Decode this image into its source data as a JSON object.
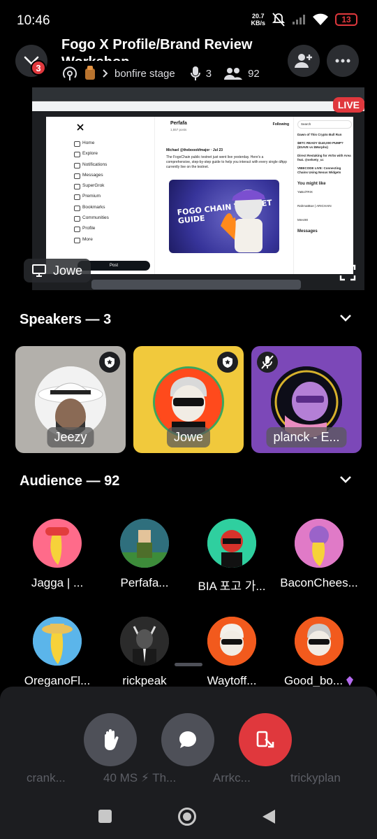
{
  "status": {
    "time": "10:46",
    "net_speed_value": "20.7",
    "net_speed_unit": "KB/s",
    "battery": "13"
  },
  "header": {
    "notification_count": "3",
    "title": "Fogo X Profile/Brand Review",
    "title_line2": "Workshop",
    "stage_name": "bonfire stage",
    "speaker_count": "3",
    "listener_count": "92"
  },
  "screenshare": {
    "live_label": "LIVE",
    "sharer_name": "Jowe",
    "x_profile_name": "Perfafa",
    "x_posts_count": "1,557 posts",
    "x_following_label": "Following",
    "x_nav": [
      "Home",
      "Explore",
      "Notifications",
      "Messages",
      "SuperGrok",
      "Premium",
      "Bookmarks",
      "Communities",
      "Profile",
      "More"
    ],
    "x_post_button": "Post",
    "x_post_author": "Michael @theboookfmajor · Jul 23",
    "x_post_text": "The FogoChain public testnet just went live yesterday. Here's a comprehensive, step-by-step guide to help you interact with every single dApp currently live on the testnet.",
    "x_image_text": "FOGO CHAIN TESTNET GUIDE",
    "x_search_placeholder": "Search",
    "x_right_items": [
      "Dawn of This Crypto Bull Run",
      "$BTC READY $140,000 PUMP? ($SAVE vs $Morpho)",
      "Direct Restaking for AVSs with Area feat. @velvety_cc",
      "VIBECODE LIVE: Connecting Chains Using Nexus Widgets"
    ],
    "x_might_like_title": "You might like",
    "x_might_like": [
      "YaBoiTRIX",
      "RahmatBoe | ARICHAIN",
      "Mrec90"
    ],
    "x_messages_label": "Messages"
  },
  "speakers": {
    "title": "Speakers — 3",
    "items": [
      {
        "name": "Jeezy",
        "bg": "#b3b0ab"
      },
      {
        "name": "Jowe",
        "bg": "#f1c93c"
      },
      {
        "name": "planck - E...",
        "bg": "#7c48b8"
      }
    ]
  },
  "audience": {
    "title": "Audience — 92",
    "items": [
      {
        "name": "Jagga | ...",
        "color": "#ff6b8a"
      },
      {
        "name": "Perfafa...",
        "color": "#3e8a9a"
      },
      {
        "name": "BIA 포고 가...",
        "color": "#2fcf9f"
      },
      {
        "name": "BaconChees...",
        "color": "#d05ec0"
      },
      {
        "name": "OreganoFl...",
        "color": "#4ea6e0"
      },
      {
        "name": "rickpeak",
        "color": "#3a3a3a"
      },
      {
        "name": "Waytoff...",
        "color": "#f25a1d"
      },
      {
        "name": "Good_bo...",
        "color": "#f25a1d"
      }
    ],
    "hidden_row": [
      "crank...",
      "40 MS ⚡ Th...",
      "Arrkc...",
      "trickyplan"
    ]
  },
  "actions": {
    "raise_hand": "raise-hand",
    "chat": "chat",
    "leave": "leave-stage"
  },
  "colors": {
    "accent_red": "#e0383d",
    "surface": "#2b2d31"
  }
}
